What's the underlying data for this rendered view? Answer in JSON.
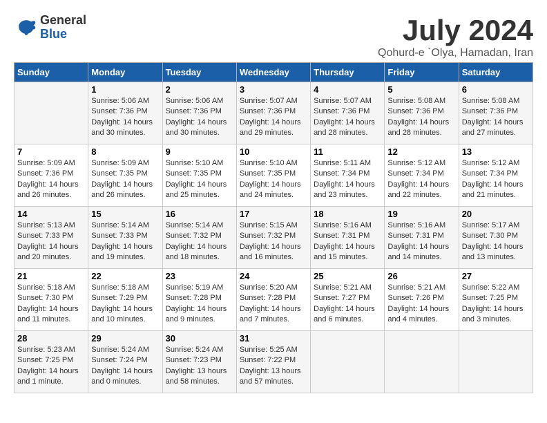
{
  "header": {
    "logo_general": "General",
    "logo_blue": "Blue",
    "main_title": "July 2024",
    "subtitle": "Qohurd-e `Olya, Hamadan, Iran"
  },
  "calendar": {
    "days_of_week": [
      "Sunday",
      "Monday",
      "Tuesday",
      "Wednesday",
      "Thursday",
      "Friday",
      "Saturday"
    ],
    "weeks": [
      [
        {
          "day": "",
          "info": ""
        },
        {
          "day": "1",
          "info": "Sunrise: 5:06 AM\nSunset: 7:36 PM\nDaylight: 14 hours\nand 30 minutes."
        },
        {
          "day": "2",
          "info": "Sunrise: 5:06 AM\nSunset: 7:36 PM\nDaylight: 14 hours\nand 30 minutes."
        },
        {
          "day": "3",
          "info": "Sunrise: 5:07 AM\nSunset: 7:36 PM\nDaylight: 14 hours\nand 29 minutes."
        },
        {
          "day": "4",
          "info": "Sunrise: 5:07 AM\nSunset: 7:36 PM\nDaylight: 14 hours\nand 28 minutes."
        },
        {
          "day": "5",
          "info": "Sunrise: 5:08 AM\nSunset: 7:36 PM\nDaylight: 14 hours\nand 28 minutes."
        },
        {
          "day": "6",
          "info": "Sunrise: 5:08 AM\nSunset: 7:36 PM\nDaylight: 14 hours\nand 27 minutes."
        }
      ],
      [
        {
          "day": "7",
          "info": "Sunrise: 5:09 AM\nSunset: 7:36 PM\nDaylight: 14 hours\nand 26 minutes."
        },
        {
          "day": "8",
          "info": "Sunrise: 5:09 AM\nSunset: 7:35 PM\nDaylight: 14 hours\nand 26 minutes."
        },
        {
          "day": "9",
          "info": "Sunrise: 5:10 AM\nSunset: 7:35 PM\nDaylight: 14 hours\nand 25 minutes."
        },
        {
          "day": "10",
          "info": "Sunrise: 5:10 AM\nSunset: 7:35 PM\nDaylight: 14 hours\nand 24 minutes."
        },
        {
          "day": "11",
          "info": "Sunrise: 5:11 AM\nSunset: 7:34 PM\nDaylight: 14 hours\nand 23 minutes."
        },
        {
          "day": "12",
          "info": "Sunrise: 5:12 AM\nSunset: 7:34 PM\nDaylight: 14 hours\nand 22 minutes."
        },
        {
          "day": "13",
          "info": "Sunrise: 5:12 AM\nSunset: 7:34 PM\nDaylight: 14 hours\nand 21 minutes."
        }
      ],
      [
        {
          "day": "14",
          "info": "Sunrise: 5:13 AM\nSunset: 7:33 PM\nDaylight: 14 hours\nand 20 minutes."
        },
        {
          "day": "15",
          "info": "Sunrise: 5:14 AM\nSunset: 7:33 PM\nDaylight: 14 hours\nand 19 minutes."
        },
        {
          "day": "16",
          "info": "Sunrise: 5:14 AM\nSunset: 7:32 PM\nDaylight: 14 hours\nand 18 minutes."
        },
        {
          "day": "17",
          "info": "Sunrise: 5:15 AM\nSunset: 7:32 PM\nDaylight: 14 hours\nand 16 minutes."
        },
        {
          "day": "18",
          "info": "Sunrise: 5:16 AM\nSunset: 7:31 PM\nDaylight: 14 hours\nand 15 minutes."
        },
        {
          "day": "19",
          "info": "Sunrise: 5:16 AM\nSunset: 7:31 PM\nDaylight: 14 hours\nand 14 minutes."
        },
        {
          "day": "20",
          "info": "Sunrise: 5:17 AM\nSunset: 7:30 PM\nDaylight: 14 hours\nand 13 minutes."
        }
      ],
      [
        {
          "day": "21",
          "info": "Sunrise: 5:18 AM\nSunset: 7:30 PM\nDaylight: 14 hours\nand 11 minutes."
        },
        {
          "day": "22",
          "info": "Sunrise: 5:18 AM\nSunset: 7:29 PM\nDaylight: 14 hours\nand 10 minutes."
        },
        {
          "day": "23",
          "info": "Sunrise: 5:19 AM\nSunset: 7:28 PM\nDaylight: 14 hours\nand 9 minutes."
        },
        {
          "day": "24",
          "info": "Sunrise: 5:20 AM\nSunset: 7:28 PM\nDaylight: 14 hours\nand 7 minutes."
        },
        {
          "day": "25",
          "info": "Sunrise: 5:21 AM\nSunset: 7:27 PM\nDaylight: 14 hours\nand 6 minutes."
        },
        {
          "day": "26",
          "info": "Sunrise: 5:21 AM\nSunset: 7:26 PM\nDaylight: 14 hours\nand 4 minutes."
        },
        {
          "day": "27",
          "info": "Sunrise: 5:22 AM\nSunset: 7:25 PM\nDaylight: 14 hours\nand 3 minutes."
        }
      ],
      [
        {
          "day": "28",
          "info": "Sunrise: 5:23 AM\nSunset: 7:25 PM\nDaylight: 14 hours\nand 1 minute."
        },
        {
          "day": "29",
          "info": "Sunrise: 5:24 AM\nSunset: 7:24 PM\nDaylight: 14 hours\nand 0 minutes."
        },
        {
          "day": "30",
          "info": "Sunrise: 5:24 AM\nSunset: 7:23 PM\nDaylight: 13 hours\nand 58 minutes."
        },
        {
          "day": "31",
          "info": "Sunrise: 5:25 AM\nSunset: 7:22 PM\nDaylight: 13 hours\nand 57 minutes."
        },
        {
          "day": "",
          "info": ""
        },
        {
          "day": "",
          "info": ""
        },
        {
          "day": "",
          "info": ""
        }
      ]
    ]
  }
}
